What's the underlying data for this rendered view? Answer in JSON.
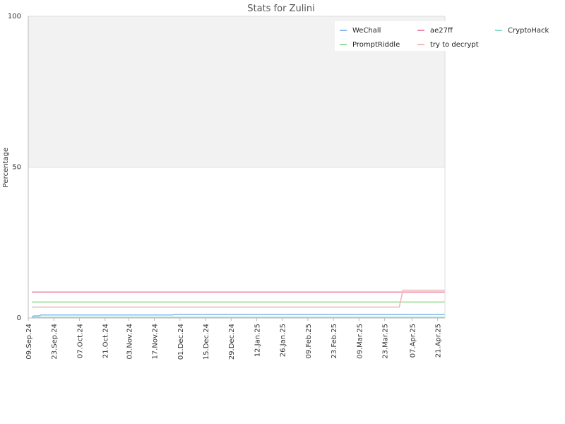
{
  "chart_data": {
    "type": "line",
    "title": "Stats for Zulini",
    "xlabel": "",
    "ylabel": "Percentage",
    "ylim": [
      0,
      100
    ],
    "yticks": [
      0,
      50,
      100
    ],
    "xlim": [
      "2024-09-09",
      "2025-04-25"
    ],
    "xticks": [
      "09.Sep.24",
      "23.Sep.24",
      "07.Oct.24",
      "21.Oct.24",
      "03.Nov.24",
      "17.Nov.24",
      "01.Dec.24",
      "15.Dec.24",
      "29.Dec.24",
      "12.Jan.25",
      "26.Jan.25",
      "09.Feb.25",
      "23.Feb.25",
      "09.Mar.25",
      "23.Mar.25",
      "07.Apr.25",
      "21.Apr.25"
    ],
    "legend_position": "top-right",
    "grid": {
      "shaded_band": [
        50,
        100
      ],
      "horizontal_lines": [
        50
      ]
    },
    "series": [
      {
        "name": "WeChall",
        "color": "#88bbee",
        "points": [
          [
            "2024-09-11",
            0.3
          ],
          [
            "2024-09-12",
            0.7
          ],
          [
            "2024-09-15",
            0.7
          ],
          [
            "2024-09-16",
            1.0
          ],
          [
            "2024-11-27",
            1.0
          ],
          [
            "2024-11-28",
            1.2
          ],
          [
            "2025-04-25",
            1.2
          ]
        ]
      },
      {
        "name": "ae27ff",
        "color": "#ee88aa",
        "points": [
          [
            "2024-09-11",
            8.6
          ],
          [
            "2025-04-25",
            8.6
          ]
        ]
      },
      {
        "name": "CryptoHack",
        "color": "#88ddcc",
        "points": [
          [
            "2024-09-11",
            0.2
          ],
          [
            "2025-04-25",
            0.2
          ]
        ]
      },
      {
        "name": "PromptRiddle",
        "color": "#99dd99",
        "points": [
          [
            "2024-09-11",
            5.3
          ],
          [
            "2025-04-25",
            5.3
          ]
        ]
      },
      {
        "name": "try to decrypt",
        "color": "#eebbbb",
        "points": [
          [
            "2024-09-11",
            3.6
          ],
          [
            "2025-03-31",
            3.6
          ],
          [
            "2025-04-02",
            9.2
          ],
          [
            "2025-04-25",
            9.2
          ]
        ]
      }
    ]
  }
}
